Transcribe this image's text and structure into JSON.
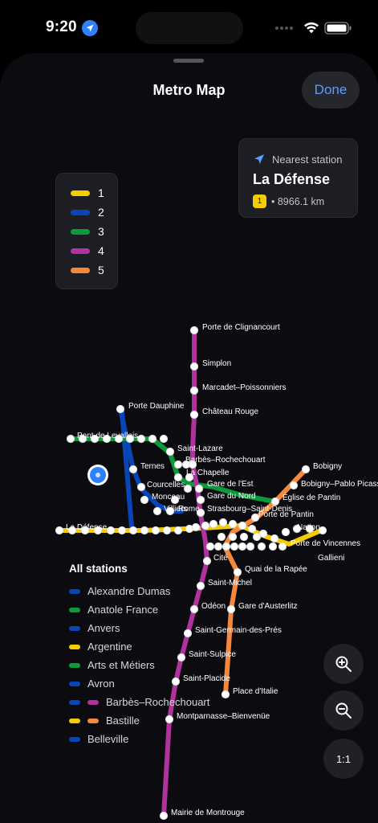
{
  "status_bar": {
    "time": "9:20"
  },
  "header": {
    "title": "Metro Map",
    "done_label": "Done"
  },
  "legend": {
    "items": [
      {
        "label": "1",
        "color": "#f5cc00"
      },
      {
        "label": "2",
        "color": "#0a45b8"
      },
      {
        "label": "3",
        "color": "#0a9a3a"
      },
      {
        "label": "4",
        "color": "#b0329c"
      },
      {
        "label": "5",
        "color": "#f5883a"
      }
    ]
  },
  "nearest": {
    "heading": "Nearest station",
    "name": "La Défense",
    "line_badge": "1",
    "distance": "• 8966.1 km"
  },
  "map": {
    "line_colors": {
      "1": "#f5cc00",
      "2": "#0a45b8",
      "3": "#0a9a3a",
      "4": "#b0329c",
      "5": "#f5883a"
    },
    "labels": [
      "Porte de Clignancourt",
      "Simplon",
      "Marcadet–Poissonniers",
      "Château Rouge",
      "Porte Dauphine",
      "Ternes",
      "Saint-Lazare",
      "Barbès–Rochechouart",
      "La Chapelle",
      "Courcelles",
      "Gare de l'Est",
      "Monceau",
      "Gare du Nord",
      "Villiers",
      "Rome",
      "Strasbourg–Saint-Denis",
      "Bobigny",
      "Bobigny–Pablo Picasso",
      "Église de Pantin",
      "Porte de Pantin",
      "Cité",
      "Quai de la Rapée",
      "Saint-Michel",
      "Gare d'Austerlitz",
      "Odéon",
      "Saint-Germain-des-Prés",
      "Saint-Sulpice",
      "Saint-Placide",
      "Place d'Italie",
      "Montparnasse–Bienvenüe",
      "Mairie de Montrouge",
      "Pont de Levallois",
      "La Défense",
      "Porte de Vincennes",
      "Gallieni",
      "Nation"
    ]
  },
  "all_stations": {
    "title": "All stations",
    "items": [
      {
        "name": "Alexandre Dumas",
        "colors": [
          "#0a45b8"
        ]
      },
      {
        "name": "Anatole France",
        "colors": [
          "#0a9a3a"
        ]
      },
      {
        "name": "Anvers",
        "colors": [
          "#0a45b8"
        ]
      },
      {
        "name": "Argentine",
        "colors": [
          "#f5cc00"
        ]
      },
      {
        "name": "Arts et Métiers",
        "colors": [
          "#0a9a3a"
        ]
      },
      {
        "name": "Avron",
        "colors": [
          "#0a45b8"
        ]
      },
      {
        "name": "Barbès–Rochechouart",
        "colors": [
          "#0a45b8",
          "#b0329c"
        ]
      },
      {
        "name": "Bastille",
        "colors": [
          "#f5cc00",
          "#f5883a"
        ]
      },
      {
        "name": "Belleville",
        "colors": [
          "#0a45b8"
        ]
      }
    ]
  },
  "zoom": {
    "in_icon": "zoom-in-icon",
    "out_icon": "zoom-out-icon",
    "reset_label": "1:1"
  }
}
